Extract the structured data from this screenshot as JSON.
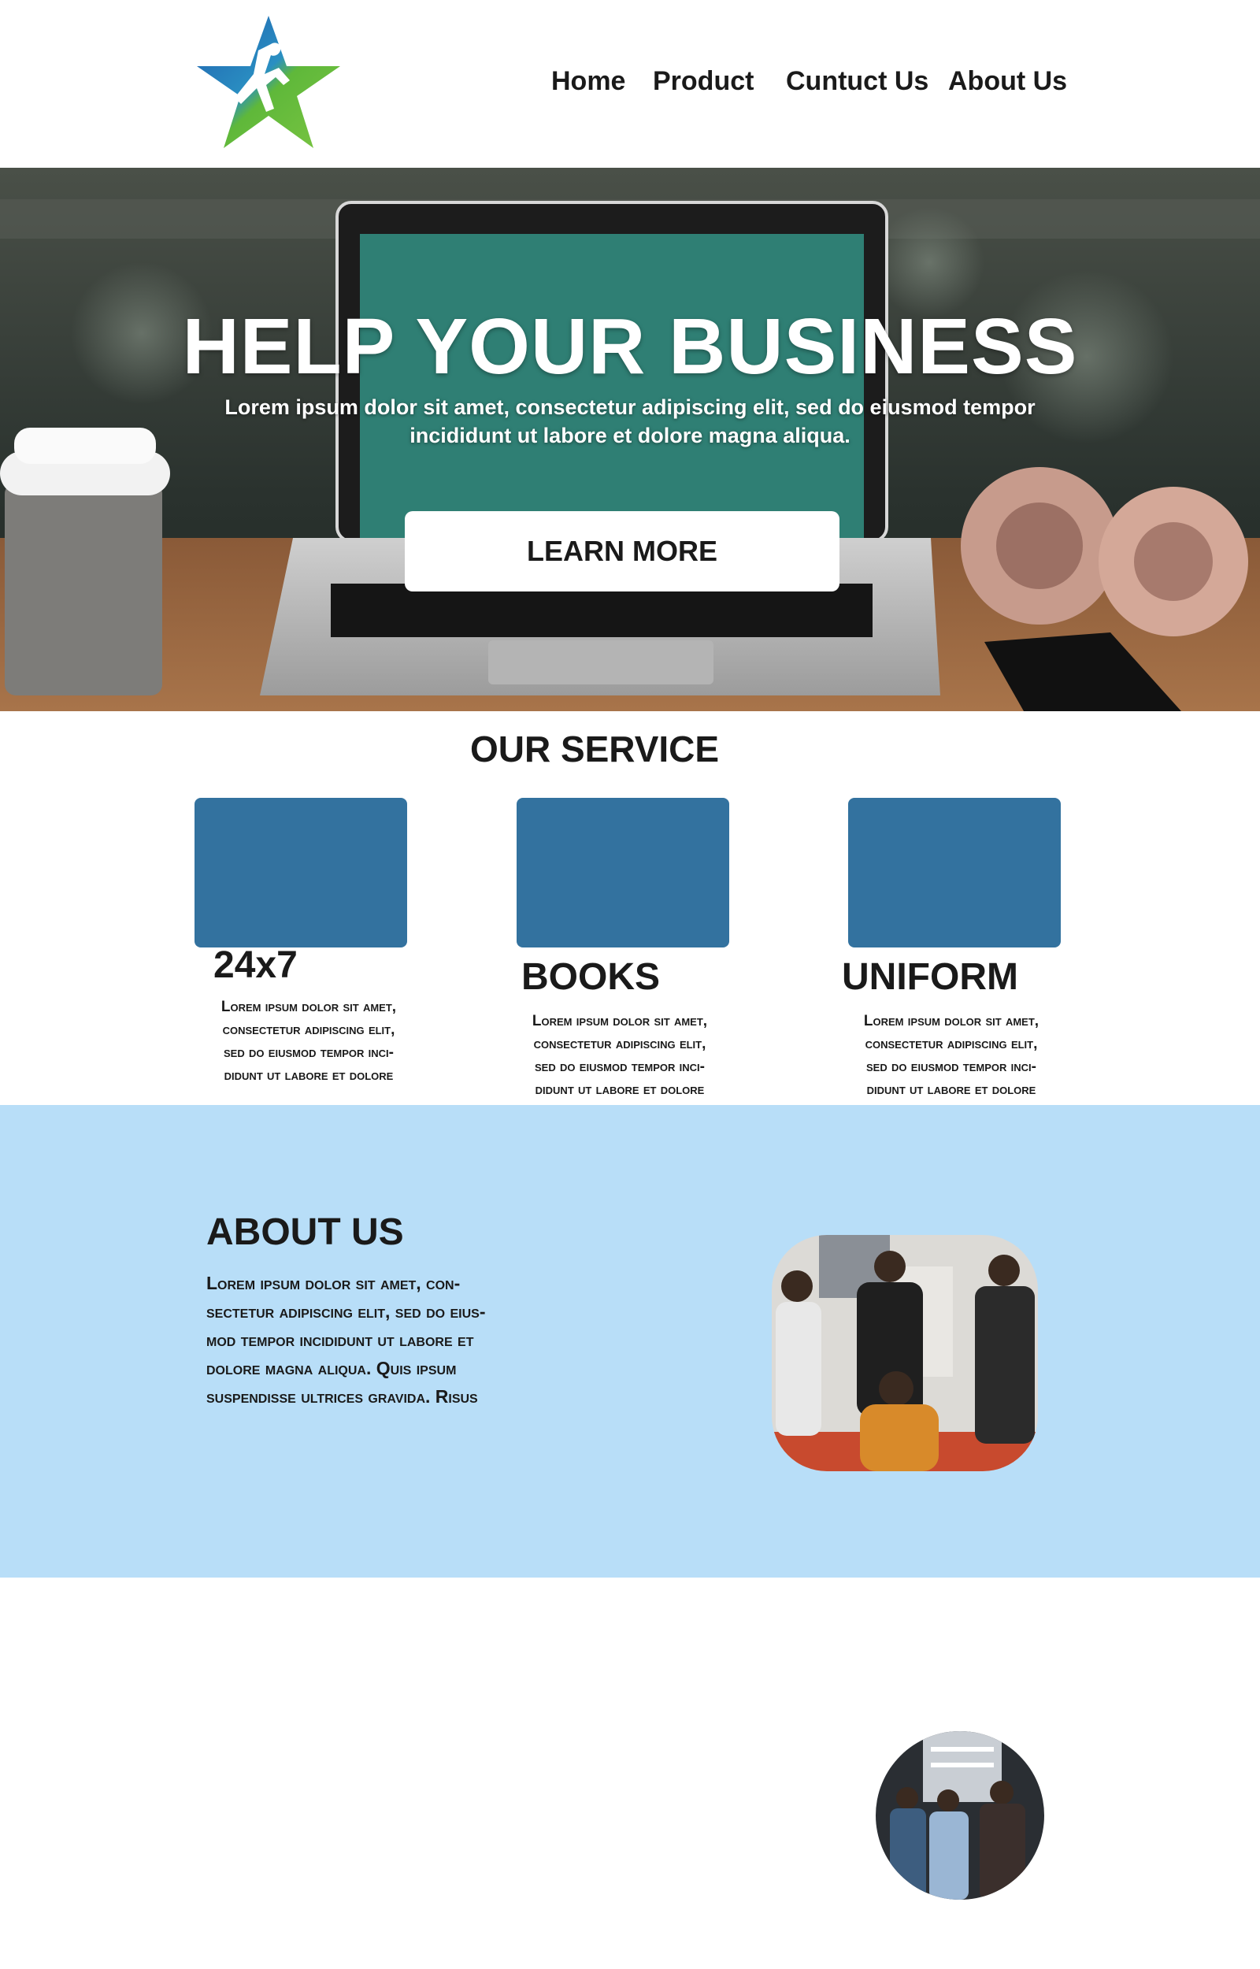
{
  "nav": {
    "items": [
      "Home",
      "Product",
      "Cuntuct Us",
      "About Us"
    ]
  },
  "hero": {
    "title": "HELP YOUR BUSINESS",
    "subtitle_line1": "Lorem ipsum dolor sit amet, consectetur adipiscing elit, sed do eiusmod tempor",
    "subtitle_line2": "incididunt ut labore et dolore magna aliqua.",
    "button_label": "LEARN MORE"
  },
  "services": {
    "title": "OUR SERVICE",
    "items": [
      {
        "title": "24x7",
        "lines": [
          "Lorem ipsum dolor sit amet,",
          "consectetur adipiscing elit,",
          "sed do eiusmod tempor inci-",
          "didunt ut labore et dolore"
        ]
      },
      {
        "title": "BOOKS",
        "lines": [
          "Lorem ipsum dolor sit amet,",
          "consectetur adipiscing elit,",
          "sed do eiusmod tempor inci-",
          "didunt ut labore et dolore"
        ]
      },
      {
        "title": "UNIFORM",
        "lines": [
          "Lorem ipsum dolor sit amet,",
          "consectetur adipiscing elit,",
          "sed do eiusmod tempor inci-",
          "didunt ut labore et dolore"
        ]
      }
    ]
  },
  "about": {
    "title": "ABOUT US",
    "lines": [
      "Lorem ipsum dolor sit amet, con-",
      "sectetur adipiscing elit, sed do eius-",
      "mod tempor incididunt ut labore et",
      "dolore magna aliqua. Quis ipsum",
      "suspendisse ultrices gravida. Risus"
    ]
  },
  "colors": {
    "service_box": "#33729f",
    "about_bg": "#b8def8",
    "logo_blue": "#1f6fb5",
    "logo_green": "#6cbf3a"
  }
}
